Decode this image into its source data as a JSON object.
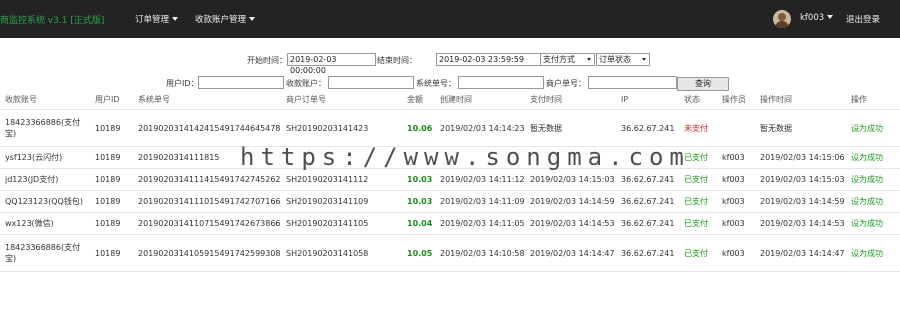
{
  "navbar": {
    "brand": "商监控系统 v3.1 [正式版]",
    "menu": [
      {
        "label": "订单管理"
      },
      {
        "label": "收款账户管理"
      }
    ],
    "user": "kf003",
    "logout": "退出登录"
  },
  "filters": {
    "start_label": "开始时间：",
    "start_value": "2019-02-03 00:00:00",
    "end_label": "结束时间：",
    "end_value": "2019-02-03 23:59:59",
    "payment_method": "支付方式",
    "order_status": "订单状态",
    "user_id_label": "用户ID：",
    "account_label": "收款账户：",
    "system_no_label": "系统单号：",
    "merchant_no_label": "商户单号：",
    "query_button": "查询"
  },
  "table": {
    "headers": [
      "收款账号",
      "用户ID",
      "系统单号",
      "商户订单号",
      "金额",
      "创建时间",
      "支付时间",
      "IP",
      "状态",
      "操作员",
      "操作时间",
      "操作"
    ],
    "rows": [
      {
        "account": "18423366886(支付宝)",
        "user_id": "10189",
        "system_no": "20190203141424154917446454788",
        "merchant_no": "SH20190203141423",
        "amount": "10.06",
        "created": "2019/02/03 14:14:23",
        "paid_time": "暂无数据",
        "ip": "36.62.67.241",
        "status": "未支付",
        "operator": "",
        "op_time": "暂无数据",
        "action": "设为成功"
      },
      {
        "account": "ysf123(云闪付)",
        "user_id": "10189",
        "system_no": "2019020314111815",
        "merchant_no": "",
        "amount": "",
        "created": "",
        "paid_time": "",
        "ip": "",
        "status": "已支付",
        "operator": "kf003",
        "op_time": "2019/02/03 14:15:06",
        "action": "设为成功"
      },
      {
        "account": "jd123(JD支付)",
        "user_id": "10189",
        "system_no": "20190203141114154917427452623",
        "merchant_no": "SH20190203141112",
        "amount": "10.03",
        "created": "2019/02/03 14:11:12",
        "paid_time": "2019/02/03 14:15:03",
        "ip": "36.62.67.241",
        "status": "已支付",
        "operator": "kf003",
        "op_time": "2019/02/03 14:15:03",
        "action": "设为成功"
      },
      {
        "account": "QQ123123(QQ钱包)",
        "user_id": "10189",
        "system_no": "20190203141110154917427071662",
        "merchant_no": "SH20190203141109",
        "amount": "10.03",
        "created": "2019/02/03 14:11:09",
        "paid_time": "2019/02/03 14:14:59",
        "ip": "36.62.67.241",
        "status": "已支付",
        "operator": "kf003",
        "op_time": "2019/02/03 14:14:59",
        "action": "设为成功"
      },
      {
        "account": "wx123(微信)",
        "user_id": "10189",
        "system_no": "20190203141107154917426738665",
        "merchant_no": "SH20190203141105",
        "amount": "10.04",
        "created": "2019/02/03 14:11:05",
        "paid_time": "2019/02/03 14:14:53",
        "ip": "36.62.67.241",
        "status": "已支付",
        "operator": "kf003",
        "op_time": "2019/02/03 14:14:53",
        "action": "设为成功"
      },
      {
        "account": "18423366886(支付宝)",
        "user_id": "10189",
        "system_no": "20190203141059154917425993082",
        "merchant_no": "SH20190203141058",
        "amount": "10.05",
        "created": "2019/02/03 14:10:58",
        "paid_time": "2019/02/03 14:14:47",
        "ip": "36.62.67.241",
        "status": "已支付",
        "operator": "kf003",
        "op_time": "2019/02/03 14:14:47",
        "action": "设为成功"
      }
    ]
  },
  "watermark": "https://www.songma.com",
  "colors": {
    "navbar_bg": "#232323",
    "paid": "#1a9a1a",
    "unpaid": "#e0201a",
    "amount": "#1a8d1a"
  }
}
